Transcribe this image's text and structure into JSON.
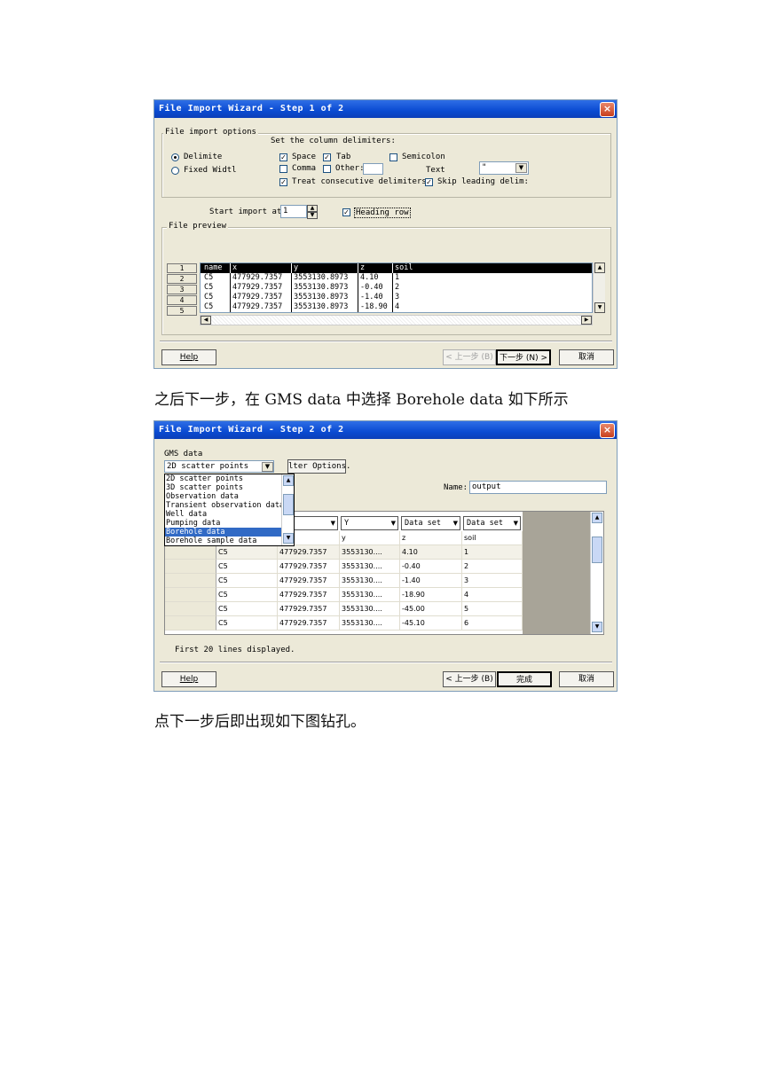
{
  "step1": {
    "title": "File Import Wizard - Step 1 of 2",
    "close": "×",
    "options_group": "File import options",
    "set_delims": "Set the column delimiters:",
    "delimited": "Delimite",
    "fixed_width": "Fixed Widtl",
    "space": "Space",
    "tab": "Tab",
    "semicolon": "Semicolon",
    "comma": "Comma",
    "other": "Other:",
    "text_label": "Text",
    "text_value": "\"",
    "treat_consecutive": "Treat consecutive delimiters",
    "skip_leading": "Skip leading delim:",
    "start_import": "Start import at",
    "start_value": "1",
    "heading_row": "Heading row",
    "preview_group": "File preview",
    "row_numbers": [
      "1",
      "2",
      "3",
      "4",
      "5"
    ],
    "headers": [
      "name",
      "x",
      "y",
      "z",
      "soil"
    ],
    "rows": [
      [
        "C5",
        "477929.7357",
        "3553130.8973",
        "4.10",
        "1"
      ],
      [
        "C5",
        "477929.7357",
        "3553130.8973",
        "-0.40",
        "2"
      ],
      [
        "C5",
        "477929.7357",
        "3553130.8973",
        "-1.40",
        "3"
      ],
      [
        "C5",
        "477929.7357",
        "3553130.8973",
        "-18.90",
        "4"
      ]
    ],
    "help": "Help",
    "back": "< 上一步 (B)",
    "next": "下一步 (N) >",
    "cancel": "取消"
  },
  "caption1": "之后下一步，在 GMS data 中选择 Borehole data 如下所示",
  "step2": {
    "title": "File Import Wizard - Step 2 of 2",
    "close": "×",
    "gms_label": "GMS data",
    "gms_selected": "2D scatter points",
    "filter_button": "lter Options.",
    "gms_options": [
      "2D scatter points",
      "3D scatter points",
      "Observation data",
      "Transient observation data",
      "Well data",
      "Pumping data",
      "Borehole data",
      "Borehole sample data"
    ],
    "gms_highlight": "Borehole data",
    "name_label": "Name:",
    "name_value": "output",
    "col_types": [
      "",
      "Y",
      "Data set",
      "Data set"
    ],
    "col_headers": [
      "",
      "y",
      "z",
      "soil"
    ],
    "rows": [
      [
        "C5",
        "477929.7357",
        "3553130....",
        "4.10",
        "1"
      ],
      [
        "C5",
        "477929.7357",
        "3553130....",
        "-0.40",
        "2"
      ],
      [
        "C5",
        "477929.7357",
        "3553130....",
        "-1.40",
        "3"
      ],
      [
        "C5",
        "477929.7357",
        "3553130....",
        "-18.90",
        "4"
      ],
      [
        "C5",
        "477929.7357",
        "3553130....",
        "-45.00",
        "5"
      ],
      [
        "C5",
        "477929.7357",
        "3553130....",
        "-45.10",
        "6"
      ]
    ],
    "status": "First 20 lines displayed.",
    "help": "Help",
    "back": "< 上一步 (B)",
    "finish": "完成",
    "cancel": "取消"
  },
  "caption2": "点下一步后即出现如下图钻孔。",
  "colors": {
    "titlebar": "#0a4bd2",
    "dialog_bg": "#ece9d8",
    "selection": "#316ac5"
  }
}
